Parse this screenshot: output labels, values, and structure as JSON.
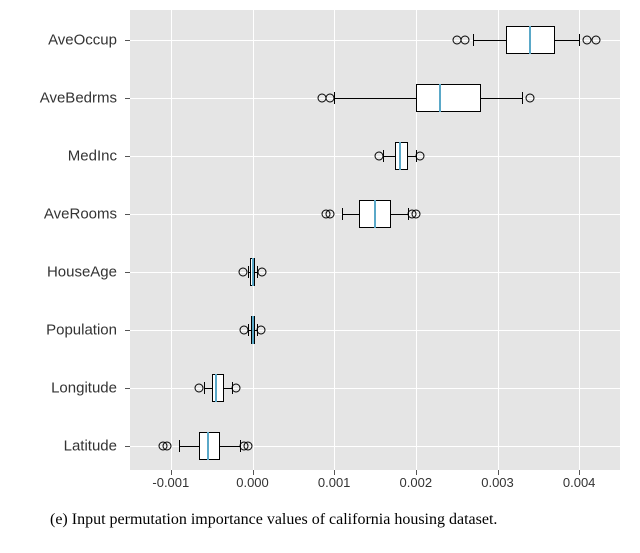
{
  "caption": "(e)  Input permutation importance values of california housing dataset.",
  "xticks": [
    "-0.001",
    "0.000",
    "0.001",
    "0.002",
    "0.003",
    "0.004"
  ],
  "categories": [
    "AveOccup",
    "AveBedrms",
    "MedInc",
    "AveRooms",
    "HouseAge",
    "Population",
    "Longitude",
    "Latitude"
  ],
  "chart_data": {
    "type": "boxplot",
    "orientation": "horizontal",
    "xlim": [
      -0.0015,
      0.0045
    ],
    "xticks": [
      -0.001,
      0.0,
      0.001,
      0.002,
      0.003,
      0.004
    ],
    "ylabel": "",
    "xlabel": "",
    "series": [
      {
        "name": "AveOccup",
        "low": 0.0027,
        "q1": 0.0031,
        "median": 0.0034,
        "q3": 0.0037,
        "high": 0.004,
        "outliers": [
          0.0025,
          0.0026,
          0.0041,
          0.0042
        ]
      },
      {
        "name": "AveBedrms",
        "low": 0.001,
        "q1": 0.002,
        "median": 0.0023,
        "q3": 0.0028,
        "high": 0.0033,
        "outliers": [
          0.00085,
          0.00095,
          0.0034
        ]
      },
      {
        "name": "MedInc",
        "low": 0.0016,
        "q1": 0.00175,
        "median": 0.0018,
        "q3": 0.0019,
        "high": 0.002,
        "outliers": [
          0.00155,
          0.00205
        ]
      },
      {
        "name": "AveRooms",
        "low": 0.0011,
        "q1": 0.0013,
        "median": 0.0015,
        "q3": 0.0017,
        "high": 0.0019,
        "outliers": [
          0.0009,
          0.00095,
          0.00195,
          0.002
        ]
      },
      {
        "name": "HouseAge",
        "low": -5e-05,
        "q1": -3e-05,
        "median": 0.0,
        "q3": 3e-05,
        "high": 5e-05,
        "outliers": [
          -0.00012,
          0.00012
        ]
      },
      {
        "name": "Population",
        "low": -5e-05,
        "q1": -2e-05,
        "median": 0.0,
        "q3": 2e-05,
        "high": 5e-05,
        "outliers": [
          -0.0001,
          0.0001
        ]
      },
      {
        "name": "Longitude",
        "low": -0.0006,
        "q1": -0.0005,
        "median": -0.00045,
        "q3": -0.00035,
        "high": -0.00025,
        "outliers": [
          -0.00065,
          -0.0002
        ]
      },
      {
        "name": "Latitude",
        "low": -0.0009,
        "q1": -0.00065,
        "median": -0.00055,
        "q3": -0.0004,
        "high": -0.00015,
        "outliers": [
          -0.0011,
          -0.00105,
          -0.0001,
          -5e-05
        ]
      }
    ]
  }
}
